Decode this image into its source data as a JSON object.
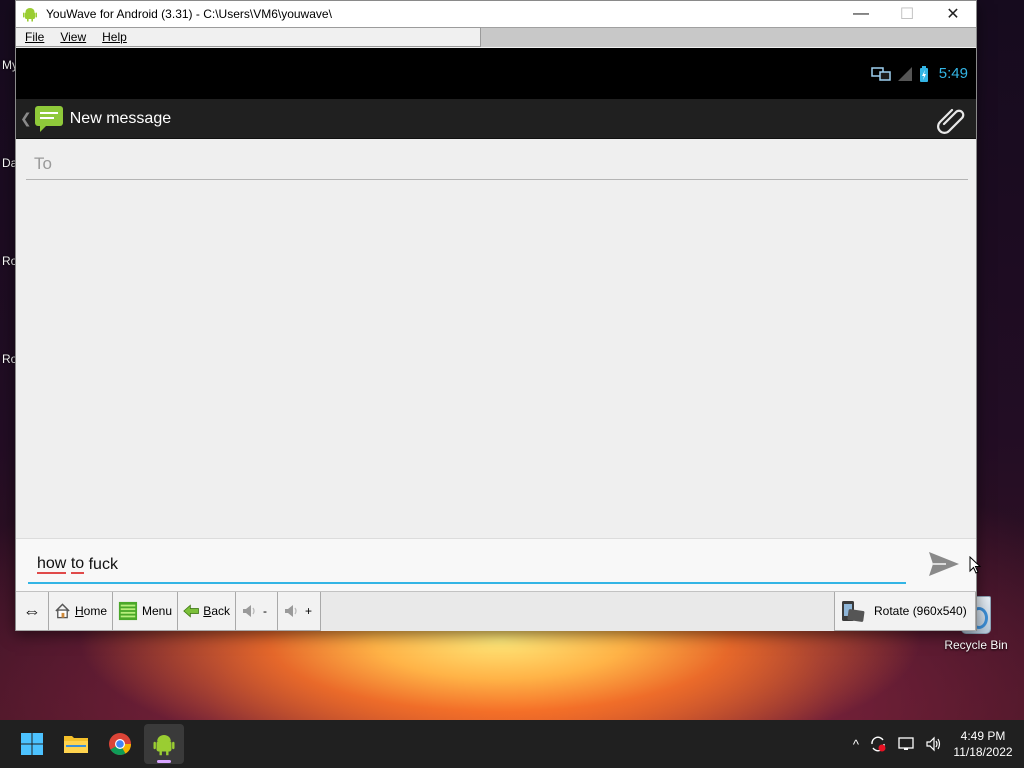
{
  "desktop": {
    "edge_labels": [
      "My",
      "Da",
      "Ro",
      "Ro"
    ],
    "recycle_bin_label": "Recycle Bin"
  },
  "window": {
    "title": "YouWave for Android (3.31) - C:\\Users\\VM6\\youwave\\",
    "minimize_glyph": "—",
    "maximize_glyph": "☐",
    "close_glyph": "✕",
    "menu": {
      "file": "File",
      "view": "View",
      "help": "Help"
    }
  },
  "android": {
    "status_time": "5:49",
    "action_bar_title": "New message",
    "up_glyph": "❮",
    "to_placeholder": "To",
    "compose_text": {
      "w1": "how",
      "w2": "to",
      "w3": "fuck"
    },
    "accent_color": "#33b5e5"
  },
  "toolbar": {
    "resize_glyph": "⇔",
    "home": {
      "hotkey": "H",
      "rest": "ome"
    },
    "menu": "Menu",
    "back": {
      "hotkey": "B",
      "rest": "ack"
    },
    "vol_down": "-",
    "vol_up": "+",
    "rotate": "Rotate (960x540)"
  },
  "taskbar": {
    "time": "4:49 PM",
    "date": "11/18/2022",
    "tray_chevron": "^"
  },
  "icons": [
    "android-icon",
    "message-icon",
    "paperclip-icon",
    "send-icon",
    "home-icon",
    "menu-icon",
    "back-icon",
    "volume-icon",
    "rotate-icon",
    "windows-start-icon",
    "file-explorer-icon",
    "chrome-icon",
    "youwave-icon",
    "sync-icon",
    "network-icon",
    "speaker-icon",
    "battery-icon",
    "signal-icon",
    "screen-icon"
  ]
}
